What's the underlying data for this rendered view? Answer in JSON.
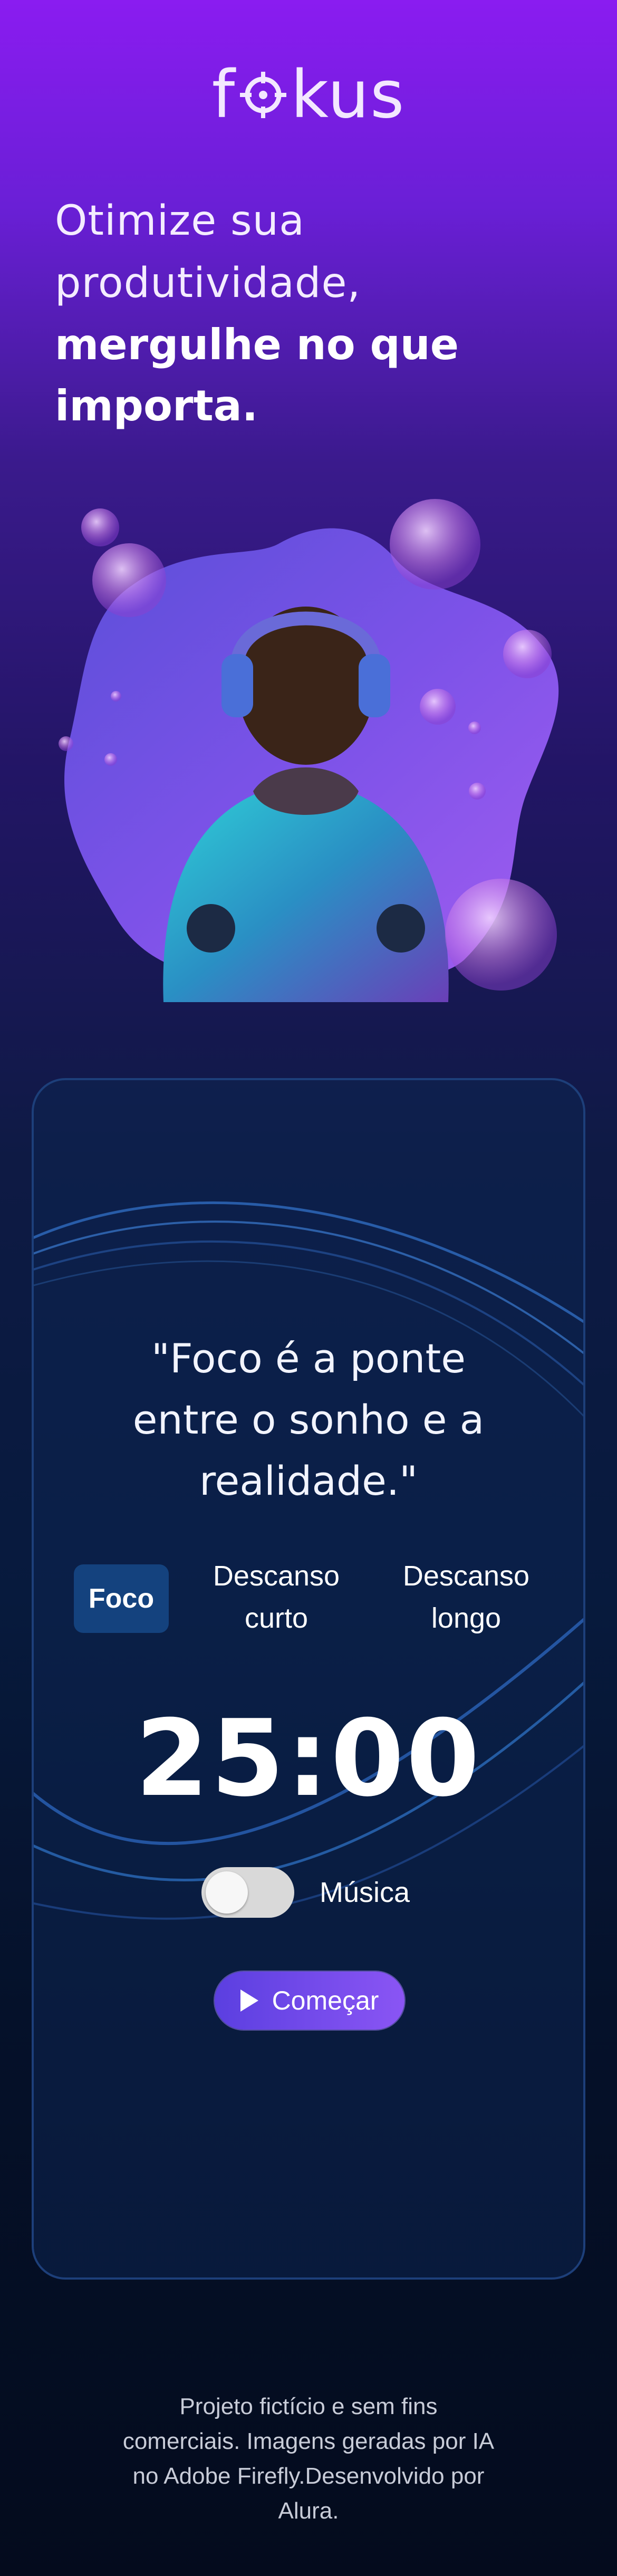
{
  "brand": {
    "logo_text": "fokus"
  },
  "headline": {
    "line1": "Otimize sua",
    "line2": "produtividade,",
    "line3": "mergulhe no que",
    "line4": "importa."
  },
  "hero": {
    "image_name": "person-with-headphones-illustration"
  },
  "timer_card": {
    "quote_line1": "\"Foco é a ponte",
    "quote_line2": "entre o sonho e a",
    "quote_line3": "realidade.\"",
    "tabs": [
      {
        "label": "Foco",
        "active": true
      },
      {
        "label_line1": "Descanso",
        "label_line2": "curto",
        "active": false
      },
      {
        "label_line1": "Descanso",
        "label_line2": "longo",
        "active": false
      }
    ],
    "time": "25:00",
    "music": {
      "label": "Música",
      "enabled": false
    },
    "start_button": {
      "label": "Começar",
      "icon": "play-icon"
    }
  },
  "footer": {
    "line1": "Projeto fictício e sem fins",
    "line2": "comerciais. Imagens geradas por IA",
    "line3": "no Adobe Firefly.Desenvolvido por",
    "line4": "Alura."
  },
  "colors": {
    "accent": "#8a55f4",
    "active_tab": "#14427e",
    "card_border": "#1d3f7a"
  }
}
